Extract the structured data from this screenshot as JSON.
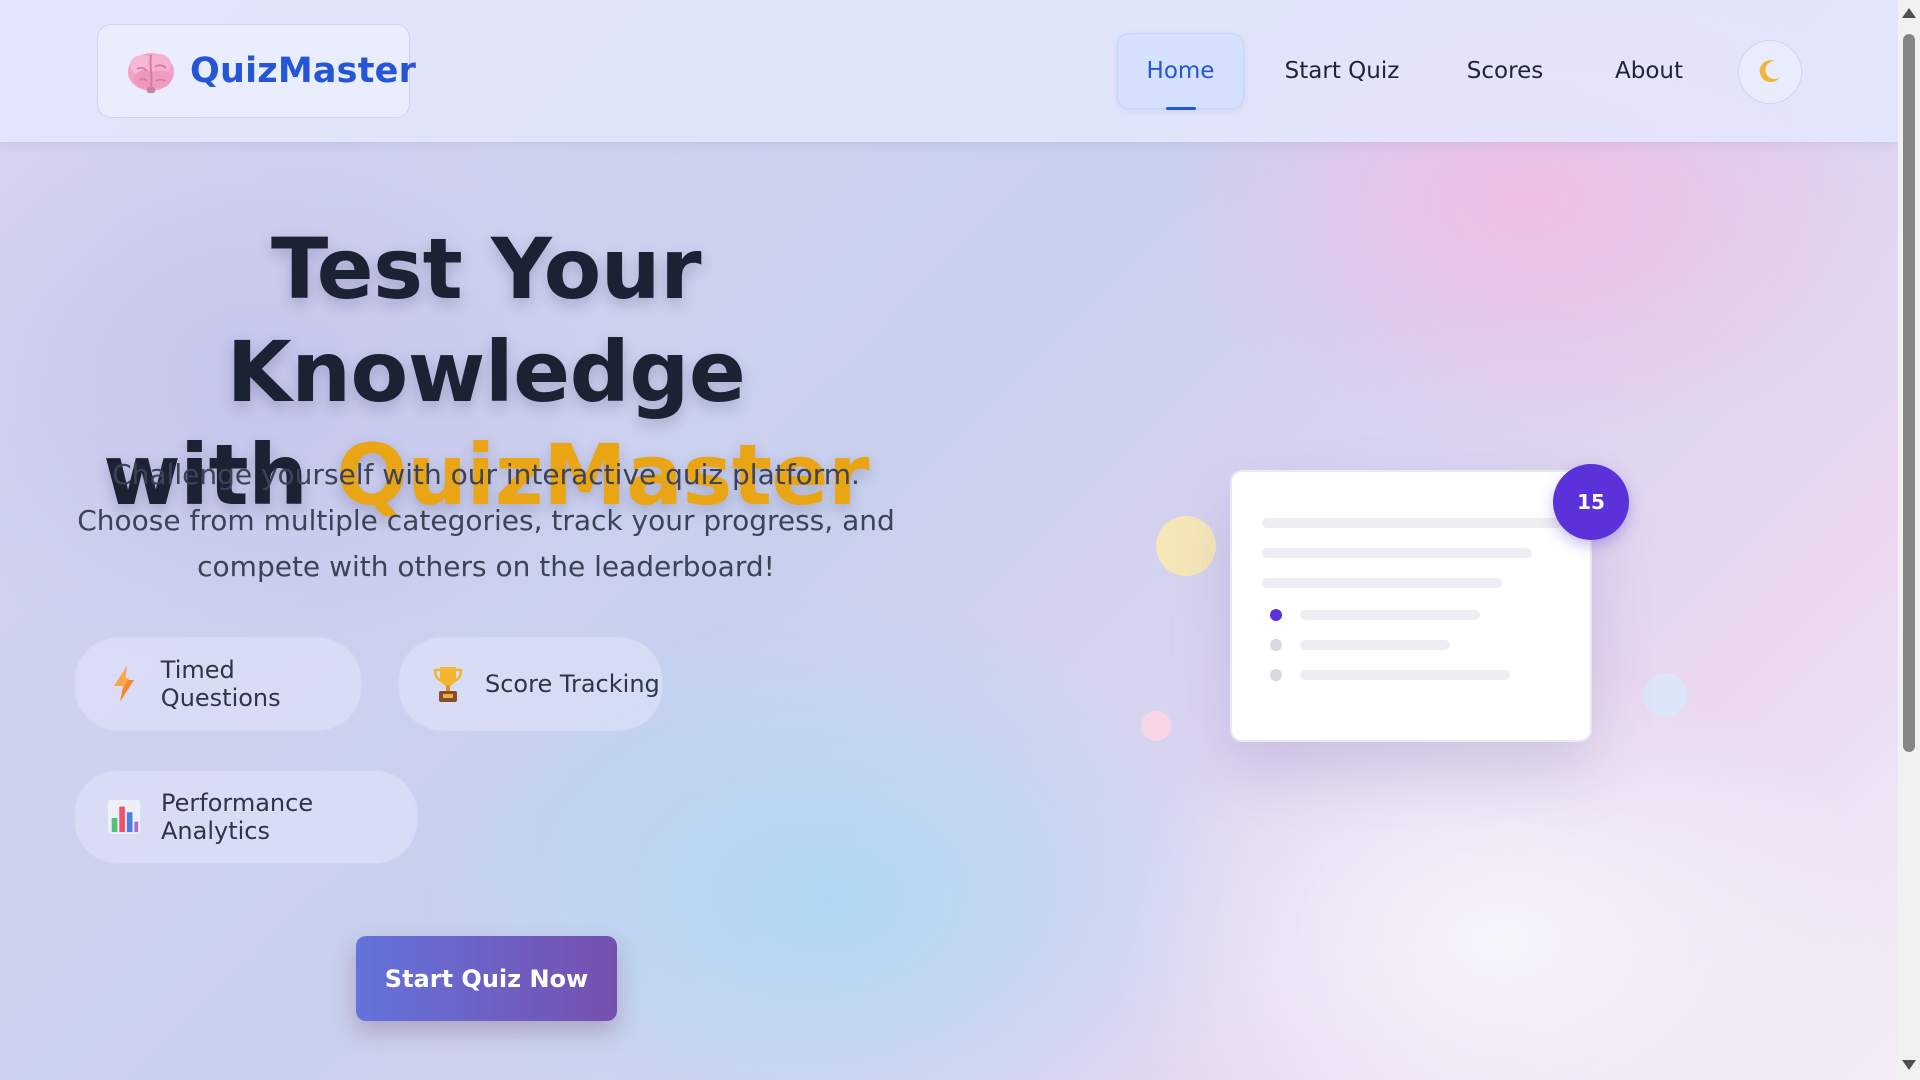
{
  "header": {
    "brand_name": "QuizMaster",
    "brand_icon": "brain-icon",
    "nav": [
      {
        "label": "Home",
        "active": true
      },
      {
        "label": "Start Quiz",
        "active": false
      },
      {
        "label": "Scores",
        "active": false
      },
      {
        "label": "About",
        "active": false
      }
    ],
    "theme_toggle_icon": "crescent-moon-icon"
  },
  "hero": {
    "title_line1": "Test Your Knowledge",
    "title_line2_prefix": "with",
    "title_line2_accent": "QuizMaster",
    "subtitle": "Challenge yourself with our interactive quiz platform. Choose from multiple categories, track your progress, and compete with others on the leaderboard!",
    "features": [
      {
        "label": "Timed Questions",
        "icon": "lightning-icon"
      },
      {
        "label": "Score Tracking",
        "icon": "trophy-icon"
      },
      {
        "label": "Performance Analytics",
        "icon": "bar-chart-icon"
      }
    ],
    "cta_label": "Start Quiz Now"
  },
  "illustration": {
    "timer_badge": "15"
  },
  "colors": {
    "brand_blue": "#2456d6",
    "accent_gold": "#e9a514",
    "cta_start": "#6373dc",
    "cta_end": "#7650ae",
    "badge_purple": "#5b32d9"
  }
}
